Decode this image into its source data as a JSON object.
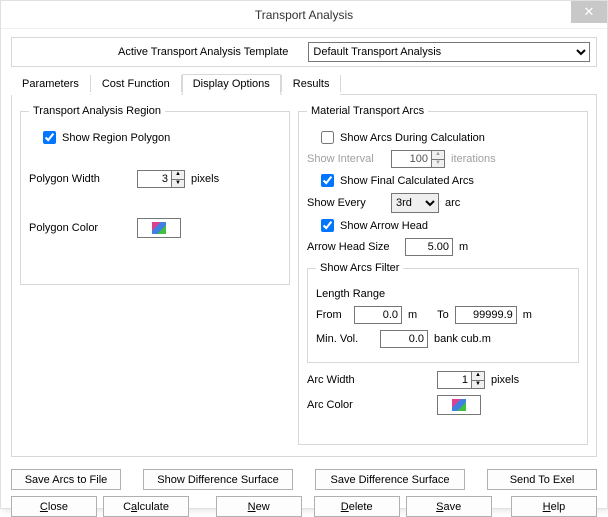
{
  "window": {
    "title": "Transport Analysis"
  },
  "template": {
    "label": "Active Transport Analysis Template",
    "selected": "Default Transport Analysis"
  },
  "tabs": {
    "parameters": "Parameters",
    "cost_function": "Cost Function",
    "display_options": "Display Options",
    "results": "Results"
  },
  "region": {
    "title": "Transport Analysis Region",
    "show_polygon": "Show Region Polygon",
    "polygon_width_label": "Polygon Width",
    "polygon_width_value": "3",
    "pixels": "pixels",
    "polygon_color_label": "Polygon Color"
  },
  "arcs": {
    "title": "Material Transport Arcs",
    "show_during": "Show Arcs During Calculation",
    "show_interval_label": "Show Interval",
    "show_interval_value": "100",
    "iterations": "iterations",
    "show_final": "Show Final Calculated Arcs",
    "show_every_label": "Show Every",
    "show_every_value": "3rd",
    "arc_unit": "arc",
    "show_arrow_head": "Show Arrow Head",
    "arrow_head_size_label": "Arrow Head Size",
    "arrow_head_size_value": "5.00",
    "m": "m",
    "filter": {
      "title": "Show Arcs Filter",
      "length_range": "Length Range",
      "from": "From",
      "from_value": "0.0",
      "to": "To",
      "to_value": "99999.9",
      "min_vol_label": "Min. Vol.",
      "min_vol_value": "0.0",
      "bank_unit": "bank cub.m"
    },
    "arc_width_label": "Arc Width",
    "arc_width_value": "1",
    "arc_color_label": "Arc Color"
  },
  "buttons": {
    "save_arcs": "Save Arcs to File",
    "show_diff": "Show Difference Surface",
    "save_diff": "Save Difference Surface",
    "send_exel": "Send To Exel",
    "close": "Close",
    "calculate": "Calculate",
    "new": "New",
    "delete": "Delete",
    "save": "Save",
    "help": "Help"
  }
}
